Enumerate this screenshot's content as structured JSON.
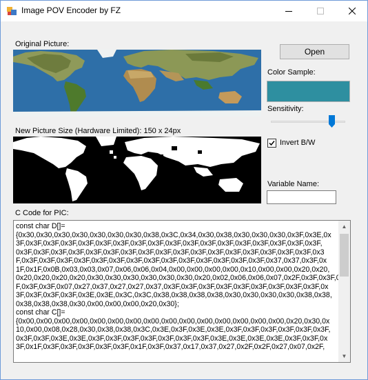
{
  "window": {
    "title": "Image POV Encoder by FZ"
  },
  "labels": {
    "original": "Original Picture:",
    "new_size": "New Picture Size (Hardware Limited): 150 x 24px",
    "color_sample": "Color Sample:",
    "sensitivity": "Sensitivity:",
    "invert": "Invert B/W",
    "variable_name": "Variable Name:",
    "c_code": "C Code for PIC:"
  },
  "buttons": {
    "open": "Open"
  },
  "color_sample": "#2e8fa0",
  "sensitivity_level": 0.85,
  "invert_checked": true,
  "variable_name_value": "",
  "code_lines": [
    "const char D[]=",
    "{0x30,0x30,0x30,0x30,0x30,0x30,0x30,0x38,0x3C,0x34,0x30,0x38,0x30,0x30,0x30,0x3F,0x3E,0x",
    "3F,0x3F,0x3F,0x3F,0x3F,0x3F,0x3F,0x3F,0x3F,0x3F,0x3F,0x3F,0x3F,0x3F,0x3F,0x3F,0x3F,0x3F,",
    "0x3F,0x3F,0x3F,0x3F,0x3F,0x3F,0x3F,0x3F,0x3F,0x3F,0x3F,0x3F,0x3F,0x3F,0x3F,0x3F,0x3F,0x3",
    "F,0x3F,0x3F,0x3F,0x3F,0x3F,0x3F,0x3F,0x3F,0x3F,0x3F,0x3F,0x3F,0x3F,0x3F,0x37,0x37,0x3F,0x",
    "1F,0x1F,0x0B,0x03,0x03,0x07,0x06,0x06,0x04,0x00,0x00,0x00,0x00,0x10,0x00,0x00,0x20,0x20,",
    "0x20,0x20,0x20,0x20,0x30,0x30,0x30,0x30,0x30,0x30,0x20,0x02,0x06,0x06,0x07,0x2F,0x3F,0x3F,0x3",
    "F,0x3F,0x3F,0x07,0x27,0x37,0x27,0x27,0x37,0x3F,0x3F,0x3F,0x3F,0x3F,0x3F,0x3F,0x3F,0x3F,0x",
    "3F,0x3F,0x3F,0x3F,0x3E,0x3E,0x3C,0x3C,0x38,0x38,0x38,0x38,0x30,0x30,0x30,0x30,0x38,0x38,",
    "0x38,0x38,0x38,0x30,0x00,0x00,0x00,0x20,0x30};",
    "const char C[]=",
    "{0x00,0x00,0x00,0x00,0x00,0x00,0x00,0x00,0x00,0x00,0x00,0x00,0x00,0x00,0x00,0x20,0x30,0x",
    "10,0x00,0x08,0x28,0x30,0x38,0x38,0x3C,0x3E,0x3F,0x3E,0x3E,0x3F,0x3F,0x3F,0x3F,0x3F,0x3F,",
    "0x3F,0x3F,0x3E,0x3E,0x3F,0x3F,0x3F,0x3F,0x3F,0x3F,0x3F,0x3E,0x3E,0x3E,0x3E,0x3F,0x3F,0x",
    "3F,0x1F,0x3F,0x3F,0x3F,0x3F,0x3F,0x1F,0x3F,0x37,0x17,0x37,0x27,0x2F,0x2F,0x27,0x07,0x2F,"
  ]
}
